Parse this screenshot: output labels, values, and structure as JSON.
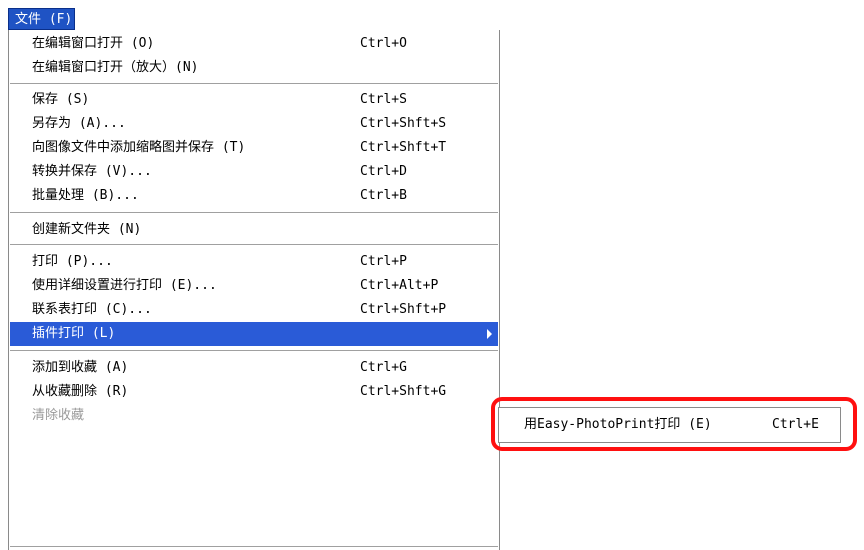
{
  "menubar": {
    "file_label": "文件 (F)"
  },
  "file_menu": {
    "items": [
      {
        "label": "在编辑窗口打开 (O)",
        "shortcut": "Ctrl+O"
      },
      {
        "label": "在编辑窗口打开（放大）(N)",
        "shortcut": ""
      },
      {
        "label": "保存 (S)",
        "shortcut": "Ctrl+S"
      },
      {
        "label": "另存为 (A)...",
        "shortcut": "Ctrl+Shft+S"
      },
      {
        "label": "向图像文件中添加缩略图并保存 (T)",
        "shortcut": "Ctrl+Shft+T"
      },
      {
        "label": "转换并保存 (V)...",
        "shortcut": "Ctrl+D"
      },
      {
        "label": "批量处理 (B)...",
        "shortcut": "Ctrl+B"
      },
      {
        "label": "创建新文件夹 (N)",
        "shortcut": ""
      },
      {
        "label": "打印 (P)...",
        "shortcut": "Ctrl+P"
      },
      {
        "label": "使用详细设置进行打印 (E)...",
        "shortcut": "Ctrl+Alt+P"
      },
      {
        "label": "联系表打印 (C)...",
        "shortcut": "Ctrl+Shft+P"
      },
      {
        "label": "插件打印 (L)",
        "shortcut": ""
      },
      {
        "label": "添加到收藏 (A)",
        "shortcut": "Ctrl+G"
      },
      {
        "label": "从收藏删除 (R)",
        "shortcut": "Ctrl+Shft+G"
      },
      {
        "label": "清除收藏",
        "shortcut": ""
      }
    ]
  },
  "plugin_submenu": {
    "items": [
      {
        "label": "用Easy-PhotoPrint打印 (E)",
        "shortcut": "Ctrl+E"
      }
    ]
  },
  "colors": {
    "menubar_active": "#1f53c4",
    "selection": "#2a5bd7",
    "highlight_frame": "#ff1010",
    "disabled_text": "#9a9a9a"
  }
}
